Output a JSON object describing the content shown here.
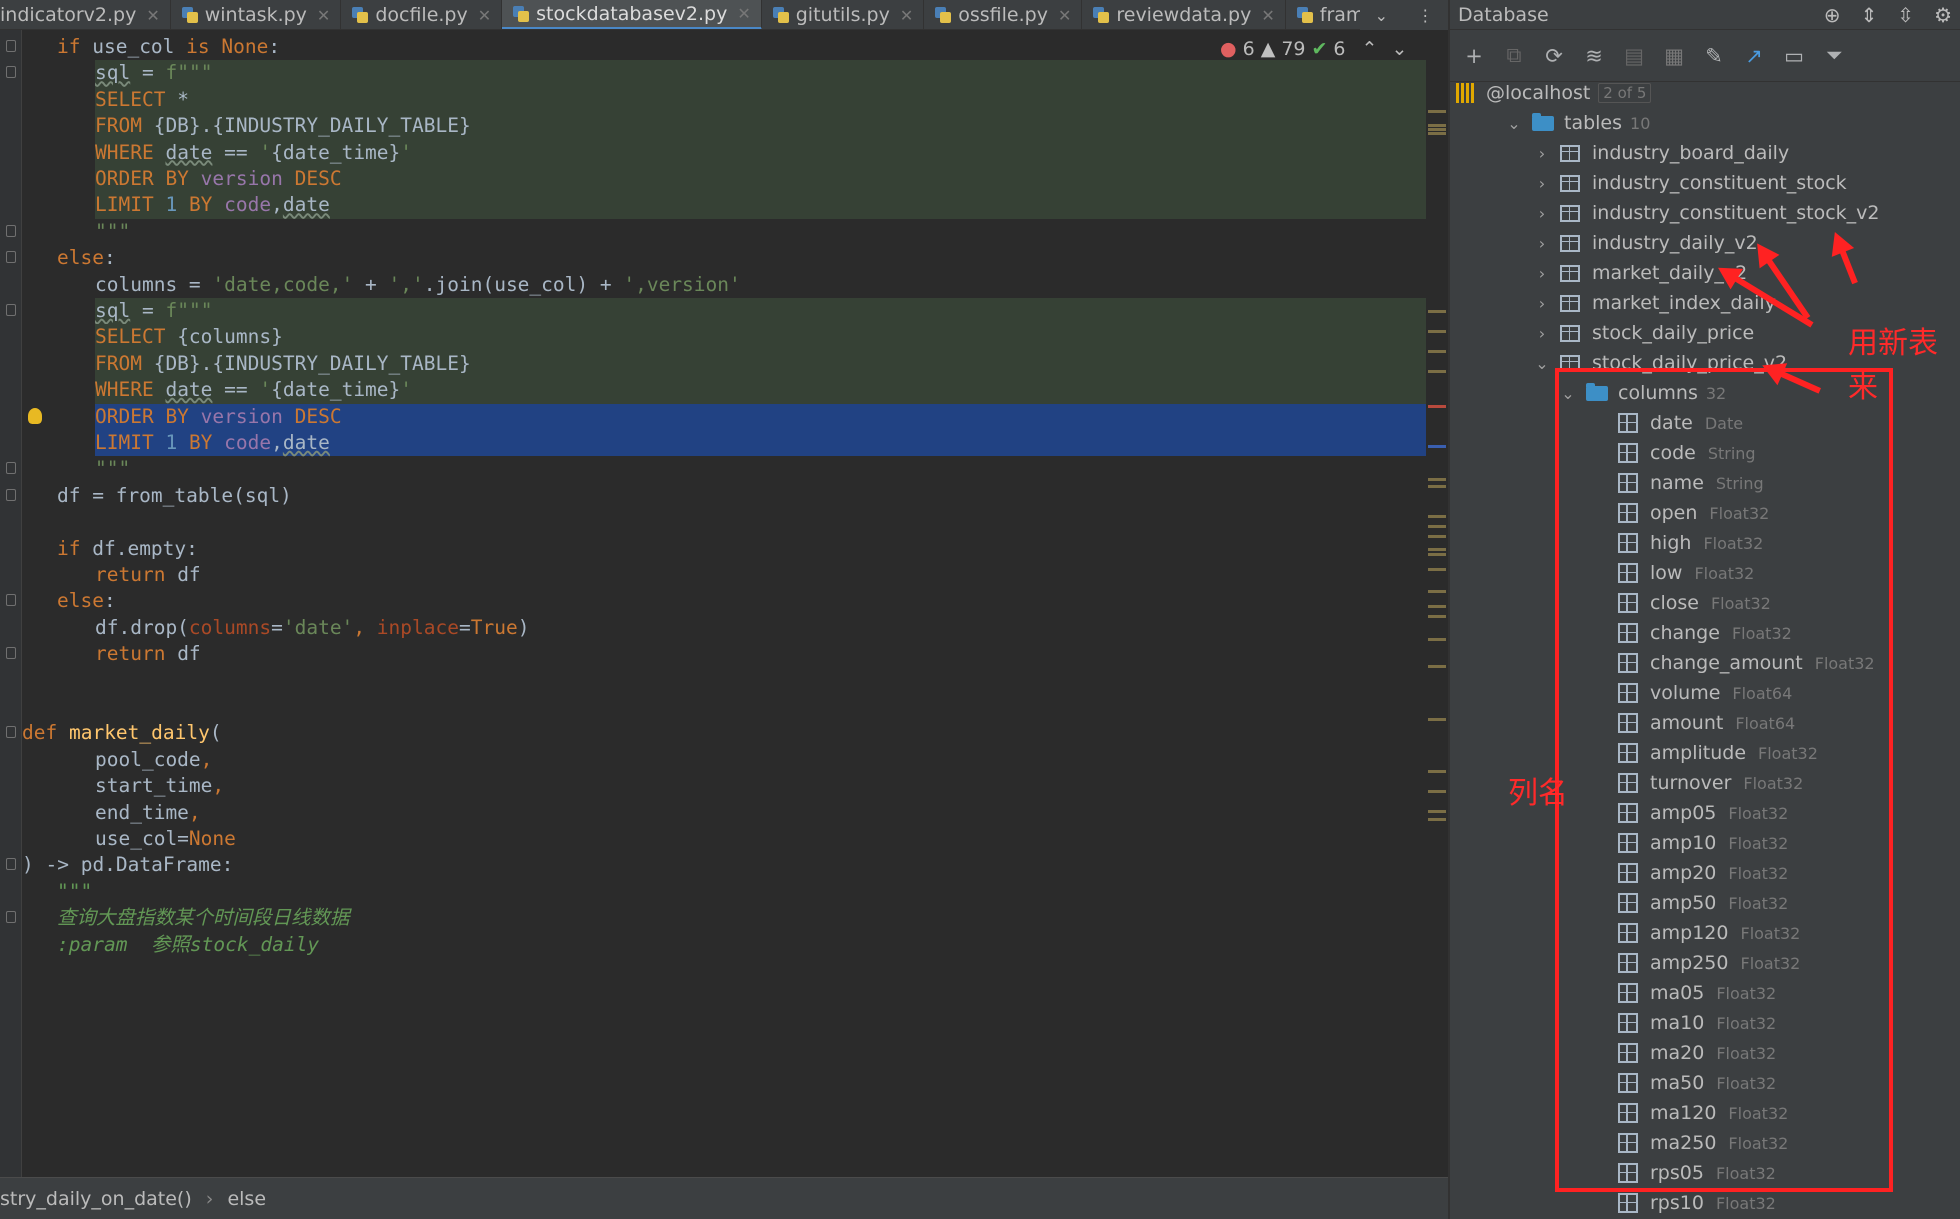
{
  "tabs": [
    {
      "label": "indicatorv2.py",
      "active": false
    },
    {
      "label": "wintask.py",
      "active": false
    },
    {
      "label": "docfile.py",
      "active": false
    },
    {
      "label": "stockdatabasev2.py",
      "active": true
    },
    {
      "label": "gitutils.py",
      "active": false
    },
    {
      "label": "ossfile.py",
      "active": false
    },
    {
      "label": "reviewdata.py",
      "active": false
    },
    {
      "label": "frame.py",
      "active": false
    }
  ],
  "status": {
    "errors": "6",
    "warnings": "79",
    "ok": "6"
  },
  "code_lines": [
    {
      "indent": 1,
      "style": "",
      "tokens": [
        [
          "kw",
          "if "
        ],
        [
          "",
          "use_col "
        ],
        [
          "kw",
          "is "
        ],
        [
          "kw",
          "None"
        ],
        [
          "",
          ":"
        ]
      ]
    },
    {
      "indent": 2,
      "style": "inj",
      "tokens": [
        [
          "uw",
          "sql"
        ],
        [
          "",
          " = "
        ],
        [
          "str",
          "f\"\"\""
        ]
      ]
    },
    {
      "indent": 2,
      "style": "inj",
      "tokens": [
        [
          "kw",
          "SELECT "
        ],
        [
          "",
          "*"
        ]
      ]
    },
    {
      "indent": 2,
      "style": "inj",
      "tokens": [
        [
          "kw",
          "FROM "
        ],
        [
          "",
          "{DB}.{INDUSTRY_DAILY_TABLE}"
        ]
      ]
    },
    {
      "indent": 2,
      "style": "inj",
      "tokens": [
        [
          "kw",
          "WHERE "
        ],
        [
          "uw",
          "date"
        ],
        [
          "",
          " == "
        ],
        [
          "str",
          "'"
        ],
        [
          "",
          "{date_time}"
        ],
        [
          "str",
          "'"
        ]
      ]
    },
    {
      "indent": 2,
      "style": "inj",
      "tokens": [
        [
          "kw",
          "ORDER BY "
        ],
        [
          "vr",
          "version"
        ],
        [
          "kw",
          " DESC"
        ]
      ]
    },
    {
      "indent": 2,
      "style": "inj",
      "tokens": [
        [
          "kw",
          "LIMIT "
        ],
        [
          "num",
          "1"
        ],
        [
          "kw",
          " BY "
        ],
        [
          "vr",
          "code"
        ],
        [
          "",
          ","
        ],
        [
          "uw",
          "date"
        ]
      ]
    },
    {
      "indent": 2,
      "style": "",
      "tokens": [
        [
          "str",
          "\"\"\""
        ]
      ]
    },
    {
      "indent": 1,
      "style": "",
      "tokens": [
        [
          "kw",
          "else"
        ],
        [
          "",
          ":"
        ]
      ]
    },
    {
      "indent": 2,
      "style": "",
      "tokens": [
        [
          "",
          "columns = "
        ],
        [
          "str",
          "'date,code,'"
        ],
        [
          "",
          " + "
        ],
        [
          "str",
          "','"
        ],
        [
          "",
          ".join(use_col) + "
        ],
        [
          "str",
          "',version'"
        ]
      ]
    },
    {
      "indent": 2,
      "style": "inj",
      "tokens": [
        [
          "uw",
          "sql"
        ],
        [
          "",
          " = "
        ],
        [
          "str",
          "f\"\"\""
        ]
      ]
    },
    {
      "indent": 2,
      "style": "inj",
      "tokens": [
        [
          "kw",
          "SELECT "
        ],
        [
          "",
          "{columns}"
        ]
      ]
    },
    {
      "indent": 2,
      "style": "inj",
      "tokens": [
        [
          "kw",
          "FROM "
        ],
        [
          "",
          "{DB}.{INDUSTRY_DAILY_TABLE}"
        ]
      ]
    },
    {
      "indent": 2,
      "style": "inj",
      "tokens": [
        [
          "kw",
          "WHERE "
        ],
        [
          "uw",
          "date"
        ],
        [
          "",
          " == "
        ],
        [
          "str",
          "'"
        ],
        [
          "",
          "{date_time}"
        ],
        [
          "str",
          "'"
        ]
      ]
    },
    {
      "indent": 2,
      "style": "sel",
      "tokens": [
        [
          "kw",
          "ORDER BY "
        ],
        [
          "vr",
          "version"
        ],
        [
          "kw",
          " DESC"
        ]
      ]
    },
    {
      "indent": 2,
      "style": "sel",
      "tokens": [
        [
          "kw",
          "LIMIT "
        ],
        [
          "num",
          "1"
        ],
        [
          "kw",
          " BY "
        ],
        [
          "vr",
          "code"
        ],
        [
          "",
          ","
        ],
        [
          "uw",
          "date"
        ]
      ]
    },
    {
      "indent": 2,
      "style": "",
      "tokens": [
        [
          "str",
          "\"\"\""
        ]
      ]
    },
    {
      "indent": 1,
      "style": "",
      "tokens": [
        [
          "",
          "df = from_table(sql)"
        ]
      ]
    },
    {
      "indent": 0,
      "style": "",
      "tokens": []
    },
    {
      "indent": 1,
      "style": "",
      "tokens": [
        [
          "kw",
          "if "
        ],
        [
          "",
          "df.empty:"
        ]
      ]
    },
    {
      "indent": 2,
      "style": "",
      "tokens": [
        [
          "kw",
          "return "
        ],
        [
          "",
          "df"
        ]
      ]
    },
    {
      "indent": 1,
      "style": "",
      "tokens": [
        [
          "kw",
          "else"
        ],
        [
          "",
          ":"
        ]
      ]
    },
    {
      "indent": 2,
      "style": "",
      "tokens": [
        [
          "",
          "df.drop("
        ],
        [
          "pm",
          "columns"
        ],
        [
          "",
          "="
        ],
        [
          "str",
          "'date'"
        ],
        [
          "kw",
          ", "
        ],
        [
          "pm",
          "inplace"
        ],
        [
          "",
          "="
        ],
        [
          "kw",
          "True"
        ],
        [
          "",
          ")"
        ]
      ]
    },
    {
      "indent": 2,
      "style": "",
      "tokens": [
        [
          "kw",
          "return "
        ],
        [
          "",
          "df"
        ]
      ]
    },
    {
      "indent": 0,
      "style": "",
      "tokens": []
    },
    {
      "indent": 0,
      "style": "",
      "tokens": []
    },
    {
      "indent": 0,
      "style": "",
      "tokens": [
        [
          "kw",
          "def "
        ],
        [
          "fn",
          "market_daily"
        ],
        [
          "",
          "("
        ]
      ]
    },
    {
      "indent": 2,
      "style": "",
      "tokens": [
        [
          "",
          "pool_code"
        ],
        [
          "kw",
          ","
        ]
      ]
    },
    {
      "indent": 2,
      "style": "",
      "tokens": [
        [
          "",
          "start_time"
        ],
        [
          "kw",
          ","
        ]
      ]
    },
    {
      "indent": 2,
      "style": "",
      "tokens": [
        [
          "",
          "end_time"
        ],
        [
          "kw",
          ","
        ]
      ]
    },
    {
      "indent": 2,
      "style": "",
      "tokens": [
        [
          "",
          "use_col="
        ],
        [
          "kw",
          "None"
        ]
      ]
    },
    {
      "indent": 0,
      "style": "",
      "tokens": [
        [
          "",
          ") -> pd.DataFrame:"
        ]
      ]
    },
    {
      "indent": 1,
      "style": "",
      "tokens": [
        [
          "cm",
          "\"\"\""
        ]
      ]
    },
    {
      "indent": 1,
      "style": "",
      "tokens": [
        [
          "cm",
          "查询大盘指数某个时间段日线数据"
        ]
      ]
    },
    {
      "indent": 1,
      "style": "",
      "tokens": [
        [
          "cm",
          ":param  参照stock_daily"
        ]
      ]
    }
  ],
  "breadcrumb": {
    "function": "stry_daily_on_date()",
    "block": "else"
  },
  "database": {
    "title": "Database",
    "host": {
      "label": "@localhost",
      "badge": "2 of 5"
    },
    "tables_folder": {
      "label": "tables",
      "count": "10"
    },
    "tables": [
      "industry_board_daily",
      "industry_constituent_stock",
      "industry_constituent_stock_v2",
      "industry_daily_v2",
      "market_daily_v2",
      "market_index_daily",
      "stock_daily_price",
      "stock_daily_price_v2"
    ],
    "columns_folder": {
      "label": "columns",
      "count": "32"
    },
    "columns": [
      {
        "name": "date",
        "type": "Date"
      },
      {
        "name": "code",
        "type": "String"
      },
      {
        "name": "name",
        "type": "String"
      },
      {
        "name": "open",
        "type": "Float32"
      },
      {
        "name": "high",
        "type": "Float32"
      },
      {
        "name": "low",
        "type": "Float32"
      },
      {
        "name": "close",
        "type": "Float32"
      },
      {
        "name": "change",
        "type": "Float32"
      },
      {
        "name": "change_amount",
        "type": "Float32"
      },
      {
        "name": "volume",
        "type": "Float64"
      },
      {
        "name": "amount",
        "type": "Float64"
      },
      {
        "name": "amplitude",
        "type": "Float32"
      },
      {
        "name": "turnover",
        "type": "Float32"
      },
      {
        "name": "amp05",
        "type": "Float32"
      },
      {
        "name": "amp10",
        "type": "Float32"
      },
      {
        "name": "amp20",
        "type": "Float32"
      },
      {
        "name": "amp50",
        "type": "Float32"
      },
      {
        "name": "amp120",
        "type": "Float32"
      },
      {
        "name": "amp250",
        "type": "Float32"
      },
      {
        "name": "ma05",
        "type": "Float32"
      },
      {
        "name": "ma10",
        "type": "Float32"
      },
      {
        "name": "ma20",
        "type": "Float32"
      },
      {
        "name": "ma50",
        "type": "Float32"
      },
      {
        "name": "ma120",
        "type": "Float32"
      },
      {
        "name": "ma250",
        "type": "Float32"
      },
      {
        "name": "rps05",
        "type": "Float32"
      },
      {
        "name": "rps10",
        "type": "Float32"
      }
    ]
  },
  "annotations": {
    "new_table_note": "用新表来",
    "column_note": "列名"
  },
  "colors": {
    "annotation": "#ff2222",
    "selection": "#214283",
    "injected_sql": "#364135"
  }
}
